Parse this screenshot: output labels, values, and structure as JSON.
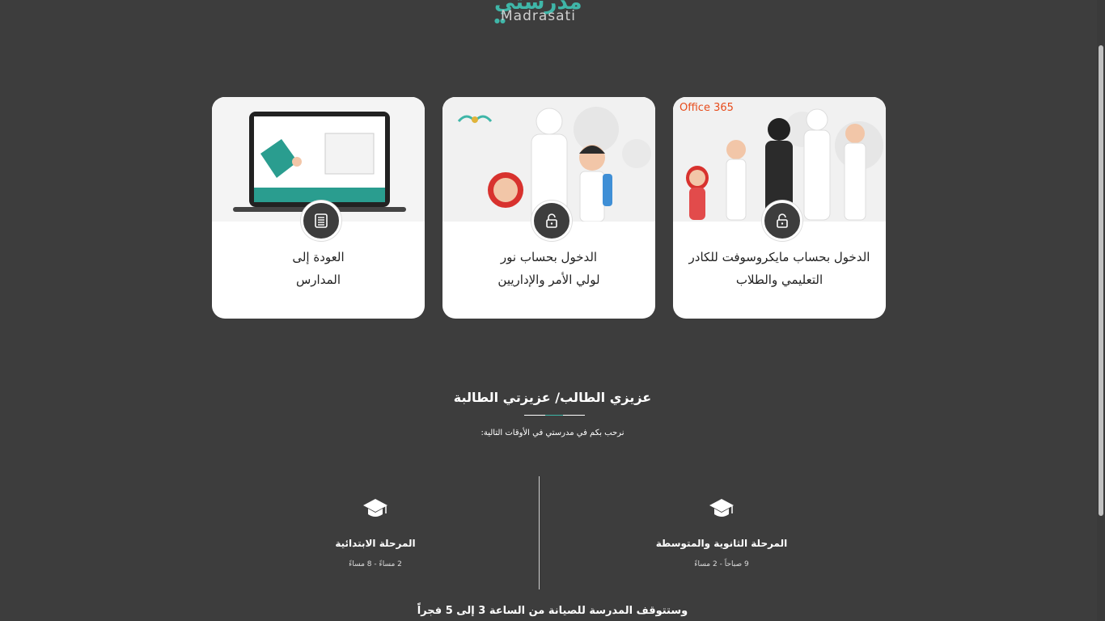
{
  "logo": {
    "arabic": "مدرستي",
    "english": "Madrasati"
  },
  "cards": [
    {
      "title_line1": "الدخول بحساب مايكروسوفت للكادر",
      "title_line2": "التعليمي والطلاب",
      "badge_icon": "lock-icon",
      "image_label": "Office 365"
    },
    {
      "title_line1": "الدخول بحساب نور",
      "title_line2": "لولي الأمر والإداريين",
      "badge_icon": "lock-icon",
      "image_label": ""
    },
    {
      "title_line1": "العودة إلى",
      "title_line2": "المدارس",
      "badge_icon": "list-icon",
      "image_label": ""
    }
  ],
  "section": {
    "title": "عزيزي الطالب/ عزيزتي الطالبة",
    "subtitle": "نرحب بكم في مدرستي في الأوقات التالية:"
  },
  "stages": [
    {
      "name": "المرحلة الثانوية والمتوسطة",
      "time": "9 صباحاً - 2 مساءً"
    },
    {
      "name": "المرحلة الابتدائية",
      "time": "2 مساءً - 8 مساءً"
    }
  ],
  "maintenance": "وستتوقف المدرسة للصيانة من الساعة 3 إلى 5 فجراً",
  "colors": {
    "background": "#3d3d3d",
    "accent": "#3fb6a8",
    "card": "#ffffff"
  }
}
